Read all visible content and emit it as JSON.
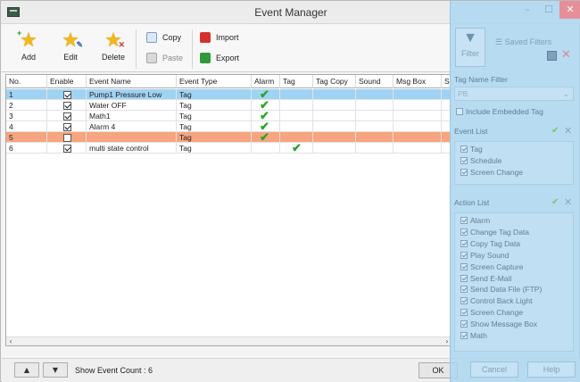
{
  "window": {
    "title": "Event Manager"
  },
  "toolbar": {
    "add_label": "Add",
    "edit_label": "Edit",
    "delete_label": "Delete",
    "copy_label": "Copy",
    "paste_label": "Paste",
    "import_label": "Import",
    "export_label": "Export"
  },
  "table": {
    "columns": [
      "No.",
      "Enable",
      "Event Name",
      "Event Type",
      "Alarm",
      "Tag",
      "Tag Copy",
      "Sound",
      "Msg Box",
      "S"
    ],
    "rows": [
      {
        "no": "1",
        "enabled": true,
        "name": "Pump1 Pressure Low",
        "type": "Tag",
        "alarm": true,
        "tag": false,
        "state": "selected"
      },
      {
        "no": "2",
        "enabled": true,
        "name": "Water OFF",
        "type": "Tag",
        "alarm": true,
        "tag": false,
        "state": "normal"
      },
      {
        "no": "3",
        "enabled": true,
        "name": "Math1",
        "type": "Tag",
        "alarm": true,
        "tag": false,
        "state": "normal"
      },
      {
        "no": "4",
        "enabled": true,
        "name": "Alarm 4",
        "type": "Tag",
        "alarm": true,
        "tag": false,
        "state": "normal"
      },
      {
        "no": "5",
        "enabled": false,
        "name": "",
        "type": "Tag",
        "alarm": true,
        "tag": false,
        "state": "disabled"
      },
      {
        "no": "6",
        "enabled": true,
        "name": "multi state control",
        "type": "Tag",
        "alarm": false,
        "tag": true,
        "state": "normal"
      }
    ]
  },
  "status": {
    "count_label": "Show Event Count : 6",
    "ok_label": "OK"
  },
  "filter_panel": {
    "filter_label": "Filter",
    "saved_filters_label": "Saved Filters",
    "tag_name_filter_label": "Tag Name Filter",
    "tag_name_value": "PB",
    "include_embedded_label": "Include Embedded Tag",
    "event_list_label": "Event List",
    "event_items": [
      "Tag",
      "Schedule",
      "Screen Change"
    ],
    "action_list_label": "Action List",
    "action_items": [
      "Alarm",
      "Change Tag Data",
      "Copy Tag Data",
      "Play Sound",
      "Screen Capture",
      "Send E-Mail",
      "Send Data File (FTP)",
      "Control Back Light",
      "Screen Change",
      "Show Message Box",
      "Math"
    ],
    "cancel_label": "Cancel",
    "help_label": "Help"
  },
  "colors": {
    "selected_row": "#9fd3f3",
    "disabled_row": "#f7a57f",
    "panel": "#aad6f0",
    "check_green": "#2aa52a"
  }
}
